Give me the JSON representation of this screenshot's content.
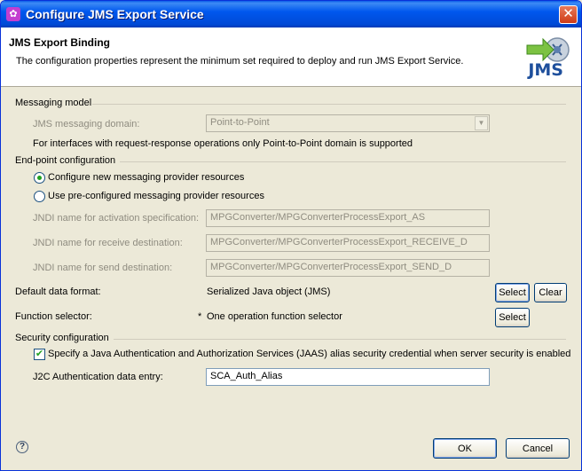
{
  "window": {
    "title": "Configure JMS Export Service",
    "close": "✕"
  },
  "header": {
    "title": "JMS Export Binding",
    "description": "The configuration properties represent the minimum set required to deploy and run JMS Export Service.",
    "logo_text": "JMS"
  },
  "messaging_model": {
    "section_label": "Messaging model",
    "domain_label": "JMS messaging domain:",
    "domain_value": "Point-to-Point",
    "note": "For interfaces with request-response operations only Point-to-Point domain is supported"
  },
  "endpoint": {
    "section_label": "End-point configuration",
    "option_new": "Configure new messaging provider resources",
    "option_preconfigured": "Use pre-configured messaging provider resources",
    "activation_label": "JNDI name for activation specification:",
    "activation_value": "MPGConverter/MPGConverterProcessExport_AS",
    "receive_label": "JNDI name for receive destination:",
    "receive_value": "MPGConverter/MPGConverterProcessExport_RECEIVE_D",
    "send_label": "JNDI name for send destination:",
    "send_value": "MPGConverter/MPGConverterProcessExport_SEND_D"
  },
  "data_format": {
    "label": "Default data format:",
    "value": "Serialized Java object (JMS)",
    "select_label": "Select",
    "clear_label": "Clear"
  },
  "function_selector": {
    "label": "Function selector:",
    "marker": "*",
    "value": "One operation function selector",
    "select_label": "Select"
  },
  "security": {
    "section_label": "Security configuration",
    "jaas_checkbox_label": "Specify a Java Authentication and Authorization Services (JAAS) alias security credential when server security is enabled",
    "jaas_checked": true,
    "j2c_label": "J2C Authentication data entry:",
    "j2c_value": "SCA_Auth_Alias"
  },
  "footer": {
    "help": "?",
    "ok_label": "OK",
    "cancel_label": "Cancel"
  },
  "colors": {
    "titlebar": "#0058ee",
    "accent": "#1e4f9c",
    "check": "#21a121"
  }
}
